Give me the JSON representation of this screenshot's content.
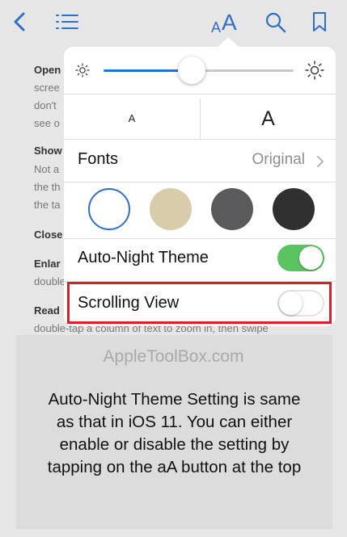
{
  "nav": {
    "back_icon": "chevron-left-icon",
    "toc_icon": "list-icon",
    "text_size_label": "AA",
    "search_icon": "search-icon",
    "bookmark_icon": "bookmark-icon"
  },
  "background_text": {
    "lines": [
      "Open",
      "scree",
      "don't",
      "see o",
      "Show",
      "Not a",
      "the th",
      "the ta",
      "Close",
      "Enlar",
      "double",
      "Read",
      "double-tap a column of text to zoom in, then swipe"
    ]
  },
  "popover": {
    "brightness": {
      "level": 0.47,
      "low_icon": "sun-small-icon",
      "high_icon": "sun-large-icon"
    },
    "font_size_small_label": "A",
    "font_size_large_label": "A",
    "fonts": {
      "label": "Fonts",
      "value": "Original"
    },
    "themes": [
      {
        "name": "white",
        "color": "#ffffff",
        "selected": true
      },
      {
        "name": "sepia",
        "color": "#d8ccaa",
        "selected": false
      },
      {
        "name": "gray",
        "color": "#5a5a5c",
        "selected": false
      },
      {
        "name": "night",
        "color": "#303030",
        "selected": false
      }
    ],
    "auto_night": {
      "label": "Auto-Night Theme",
      "on": true
    },
    "scrolling_view": {
      "label": "Scrolling View",
      "on": false
    }
  },
  "colors": {
    "accent": "#2f6fc8",
    "toggle_on": "#5ac560",
    "highlight": "#d9202a"
  },
  "watermark": "AppleToolBox.com",
  "caption": {
    "lines": [
      "Auto-Night Theme Setting is same",
      "as that in iOS 11. You can either",
      "enable or disable the setting by",
      "tapping on the aA button at the top"
    ]
  }
}
